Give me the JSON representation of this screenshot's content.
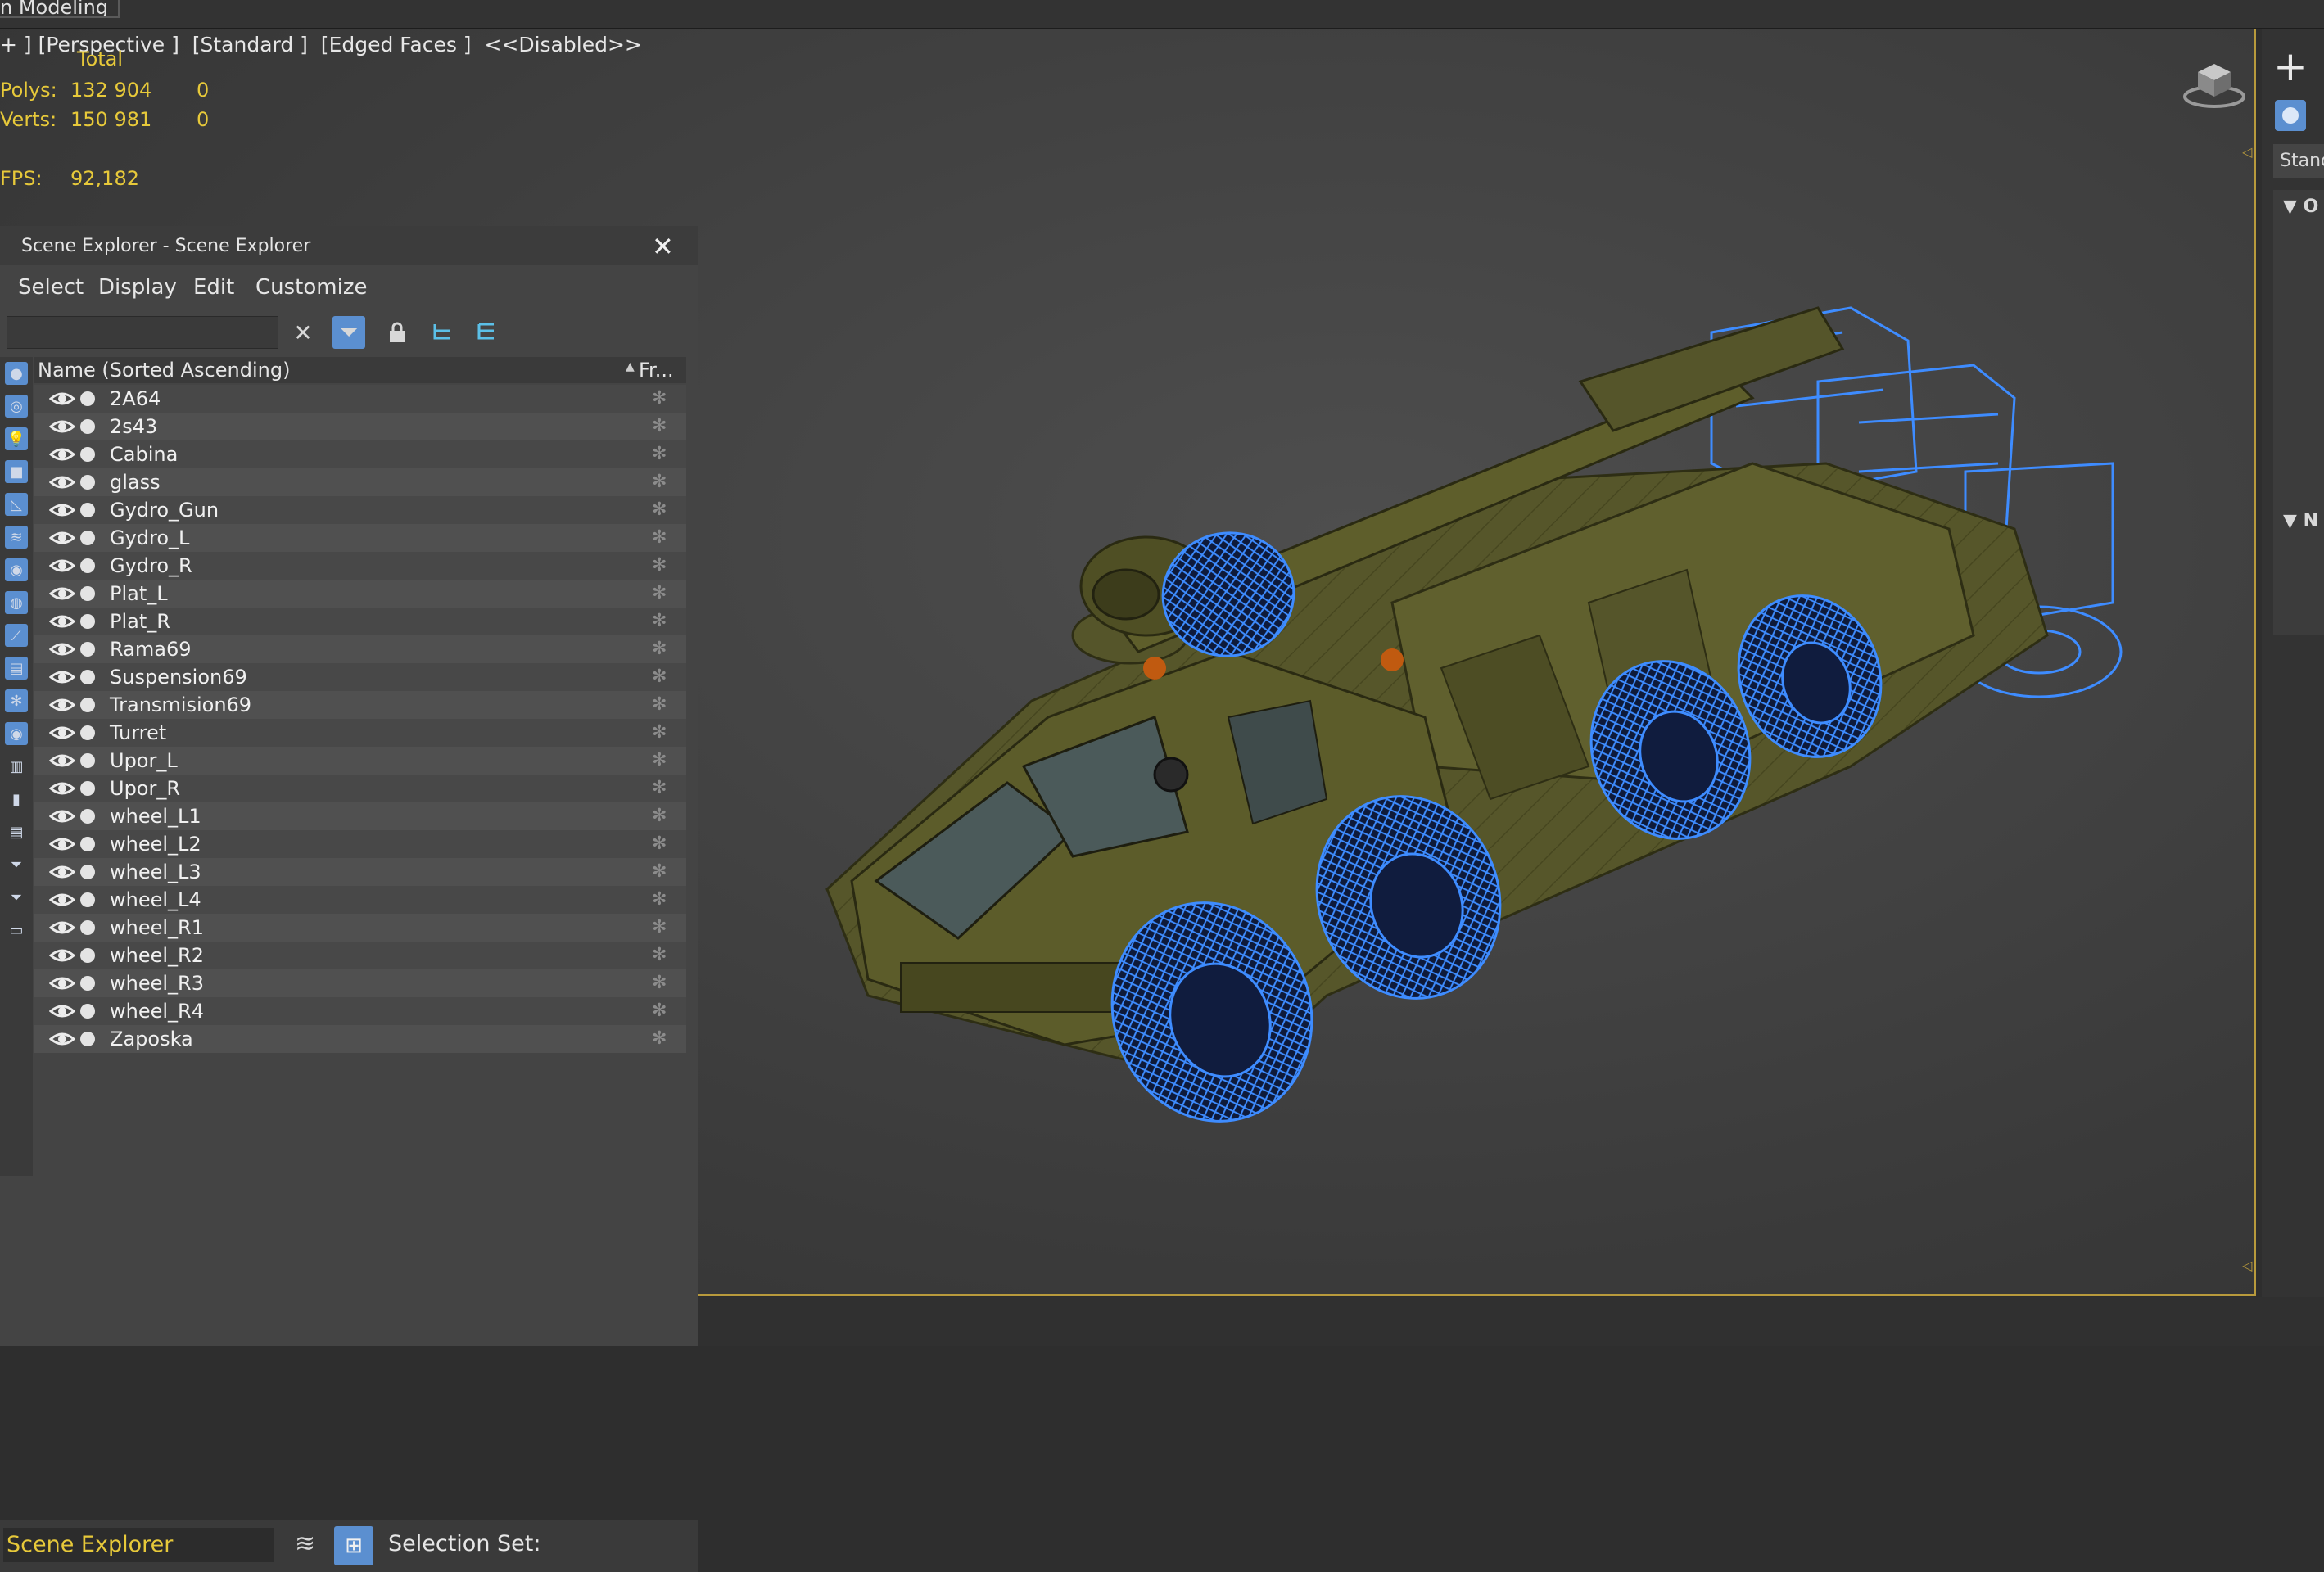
{
  "ribbon": {
    "tab_label": "n Modeling"
  },
  "viewport": {
    "label": "+ ] [Perspective ]  [Standard ]  [Edged Faces ]  <<Disabled>>",
    "stats": {
      "total_header": "Total",
      "polys_label": "Polys:",
      "polys_total": "132 904",
      "polys_selected": "0",
      "verts_label": "Verts:",
      "verts_total": "150 981",
      "verts_selected": "0",
      "fps_label": "FPS:",
      "fps_value": "92,182"
    },
    "viewcube_icon": "viewcube-icon"
  },
  "command_panel": {
    "create_icon": "plus-icon",
    "geometry_icon": "sphere-icon",
    "category_value": "Standa",
    "rollout1_title": "O",
    "rollout2_title": "N"
  },
  "scene_explorer": {
    "title": "Scene Explorer - Scene Explorer",
    "close_icon": "close-icon",
    "menus": [
      "Select",
      "Display",
      "Edit",
      "Customize"
    ],
    "search_value": "",
    "columns": {
      "name": "Name (Sorted Ascending)",
      "freeze": "Fr..."
    },
    "objects": [
      "2A64",
      "2s43",
      "Cabina",
      "glass",
      "Gydro_Gun",
      "Gydro_L",
      "Gydro_R",
      "Plat_L",
      "Plat_R",
      "Rama69",
      "Suspension69",
      "Transmision69",
      "Turret",
      "Upor_L",
      "Upor_R",
      "wheel_L1",
      "wheel_L2",
      "wheel_L3",
      "wheel_L4",
      "wheel_R1",
      "wheel_R2",
      "wheel_R3",
      "wheel_R4",
      "Zaposka"
    ],
    "bottom": {
      "explorer_name": "Scene Explorer",
      "selection_set_label": "Selection Set:"
    }
  },
  "colors": {
    "accent_blue": "#5b8fd0",
    "stats_yellow": "#e7c93a",
    "viewport_border": "#b89a3c",
    "model_olive": "#5a5a28",
    "wire_blue": "#3e8cff"
  }
}
